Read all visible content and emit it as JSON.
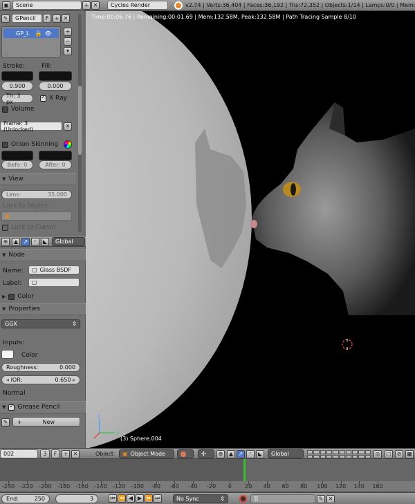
{
  "topbar": {
    "scene": "Scene",
    "engine": "Cycles Render",
    "stats": "v2.74 | Verts:36,404 | Faces:36,192 | Tris:72,352 | Objects:1/14 | Lamps:0/0 | Mem:1049."
  },
  "viewport": {
    "render_info": "Time:00:06.76 | Remaining:00:01.69 | Mem:132.58M, Peak:132.58M | Path Tracing Sample 8/10",
    "object_label": "(3) Sphere.004"
  },
  "gpencil": {
    "datablock": "GPencil",
    "fake_user": "F",
    "layer": "GP_L",
    "stroke_label": "Stroke:",
    "fill_label": "Fill:",
    "stroke_value": "0.900",
    "fill_value": "0.000",
    "thickness": "Th: 3 px",
    "xray": "X Ray",
    "volume": "Volume",
    "frame": "Frame: 3 (Unlocked)",
    "onion": "Onion Skinning",
    "before": "Befo: 0",
    "after": "After: 0"
  },
  "view_panel": {
    "title": "View",
    "lens": "Lens:",
    "lens_value": "35.000",
    "lock_object": "Lock to Object:",
    "lock_cursor": "Lock to Cursor"
  },
  "node_toolbar": {
    "orientation": "Global"
  },
  "node_panel": {
    "title": "Node",
    "name_label": "Name:",
    "name_value": "Glass BSDF",
    "label_label": "Label:",
    "color_title": "Color",
    "properties_title": "Properties",
    "distribution": "GGX",
    "inputs_label": "Inputs:",
    "color_input": "Color",
    "roughness_label": "Roughness:",
    "roughness_value": "0.000",
    "ior_label": "IOR:",
    "ior_value": "0.650",
    "normal_label": "Normal",
    "grease_title": "Grease Pencil",
    "new_label": "New"
  },
  "view3d_header": {
    "datablock": "002",
    "users": "3",
    "fake": "F",
    "menu_object": "Object",
    "mode": "Object Mode",
    "orientation": "Global"
  },
  "timeline": {
    "ticks": [
      "-240",
      "-220",
      "-200",
      "-180",
      "-160",
      "-140",
      "-120",
      "-100",
      "-80",
      "-60",
      "-40",
      "-20",
      "0",
      "20",
      "40",
      "60",
      "80",
      "100",
      "120",
      "140",
      "160"
    ],
    "end_label": "End:",
    "end_value": "250",
    "current_frame": "3",
    "sync": "No Sync"
  },
  "colors": {
    "accent_blue": "#4f79c7",
    "viewport_bg": "#000000",
    "panel_bg": "#727272",
    "playhead": "#39c12a"
  }
}
